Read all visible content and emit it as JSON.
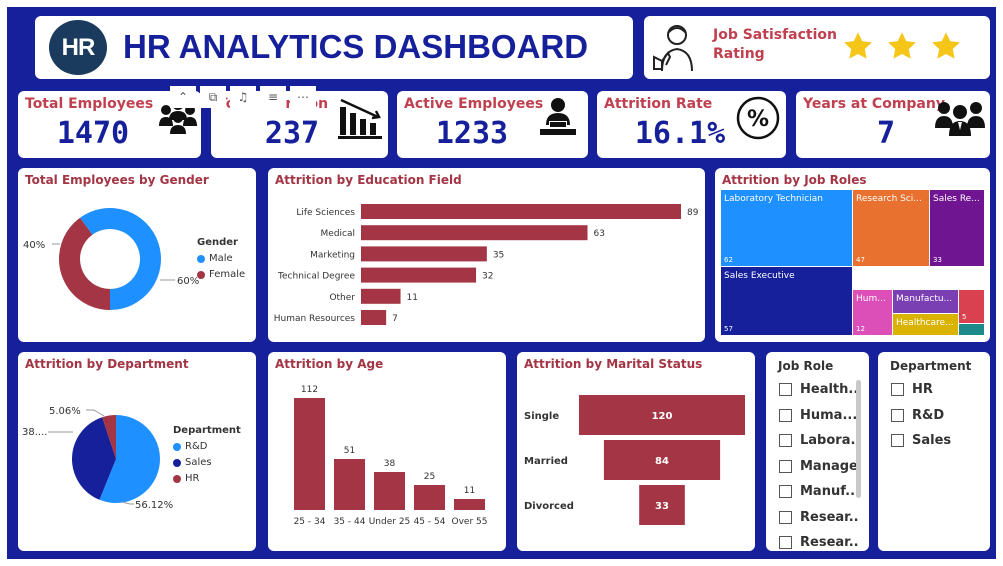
{
  "header": {
    "logo_text": "HR",
    "title": "HR ANALYTICS DASHBOARD"
  },
  "satisfaction": {
    "label_line1": "Job Satisfaction",
    "label_line2": "Rating",
    "stars": 3,
    "star_color": "#f5c518"
  },
  "kpis": [
    {
      "title": "Total Employees",
      "value": "1470",
      "icon": "people-group-icon"
    },
    {
      "title": "Total Attrition",
      "value": "237",
      "icon": "bar-chart-down-icon"
    },
    {
      "title": "Active Employees",
      "value": "1233",
      "icon": "person-at-desk-icon"
    },
    {
      "title": "Attrition Rate",
      "value": "16.1%",
      "icon": "percent-icon"
    },
    {
      "title": "Years at Company",
      "value": "7",
      "icon": "team-icon"
    }
  ],
  "visual_toolbar": {
    "icons": [
      "focus-mode-icon",
      "copy-icon",
      "bell-icon",
      "filter-icon",
      "more-options-icon"
    ]
  },
  "colors": {
    "frame": "#16209a",
    "accent_red": "#a33544",
    "blue": "#1e90ff",
    "navy": "#16209a"
  },
  "gender_card": {
    "title": "Total Employees by Gender",
    "legend_title": "Gender",
    "labels": {
      "female_pct": "40%",
      "male_pct": "60%"
    }
  },
  "education_card": {
    "title": "Attrition by Education Field"
  },
  "jobroles_card": {
    "title": "Attrition by Job Roles",
    "tiles": [
      {
        "label": "Laboratory Technician",
        "value": "62",
        "color": "#1e90ff"
      },
      {
        "label": "Research Sci...",
        "value": "47",
        "color": "#e8712f"
      },
      {
        "label": "Sales Re...",
        "value": "33",
        "color": "#6f1591"
      },
      {
        "label": "Sales Executive",
        "value": "57",
        "color": "#16209a"
      },
      {
        "label": "Hum...",
        "value": "12",
        "color": "#dd4fb8"
      },
      {
        "label": "Manufactu...",
        "value": "",
        "color": "#7a3fb3"
      },
      {
        "label": "",
        "value": "5",
        "color": "#d94050"
      },
      {
        "label": "Healthcare...",
        "value": "",
        "color": "#d9b300"
      },
      {
        "label": "",
        "value": "",
        "color": "#1d8a8a"
      }
    ]
  },
  "department_card": {
    "title": "Attrition by Department",
    "legend_title": "Department",
    "labels": {
      "hr_pct": "5.06%",
      "sales_pct": "38....",
      "rd_pct": "56.12%"
    }
  },
  "age_card": {
    "title": "Attrition by Age"
  },
  "marital_card": {
    "title": "Attrition by Marital Status"
  },
  "jobrole_slicer": {
    "title": "Job Role",
    "items": [
      "Health...",
      "Huma...",
      "Labora...",
      "Manager",
      "Manuf...",
      "Resear...",
      "Resear..."
    ]
  },
  "department_slicer": {
    "title": "Department",
    "items": [
      "HR",
      "R&D",
      "Sales"
    ]
  },
  "chart_data": [
    {
      "type": "pie",
      "title": "Total Employees by Gender",
      "donut": true,
      "categories": [
        "Male",
        "Female"
      ],
      "values": [
        60,
        40
      ],
      "colors": [
        "#1e90ff",
        "#a33544"
      ],
      "legend_position": "right"
    },
    {
      "type": "bar",
      "orientation": "horizontal",
      "title": "Attrition by Education Field",
      "categories": [
        "Life Sciences",
        "Medical",
        "Marketing",
        "Technical Degree",
        "Other",
        "Human Resources"
      ],
      "values": [
        89,
        63,
        35,
        32,
        11,
        7
      ],
      "xlim": [
        0,
        89
      ],
      "color": "#a33544"
    },
    {
      "type": "pie",
      "title": "Attrition by Department",
      "categories": [
        "R&D",
        "Sales",
        "HR"
      ],
      "values": [
        56.12,
        38.82,
        5.06
      ],
      "colors": [
        "#1e90ff",
        "#16209a",
        "#a33544"
      ],
      "legend_position": "right"
    },
    {
      "type": "bar",
      "title": "Attrition by Age",
      "categories": [
        "25 - 34",
        "35 - 44",
        "Under 25",
        "45 - 54",
        "Over 55"
      ],
      "values": [
        112,
        51,
        38,
        25,
        11
      ],
      "ylim": [
        0,
        112
      ],
      "color": "#a33544"
    },
    {
      "type": "bar",
      "subtype": "funnel",
      "title": "Attrition by Marital Status",
      "categories": [
        "Single",
        "Married",
        "Divorced"
      ],
      "values": [
        120,
        84,
        33
      ],
      "color": "#a33544"
    }
  ]
}
